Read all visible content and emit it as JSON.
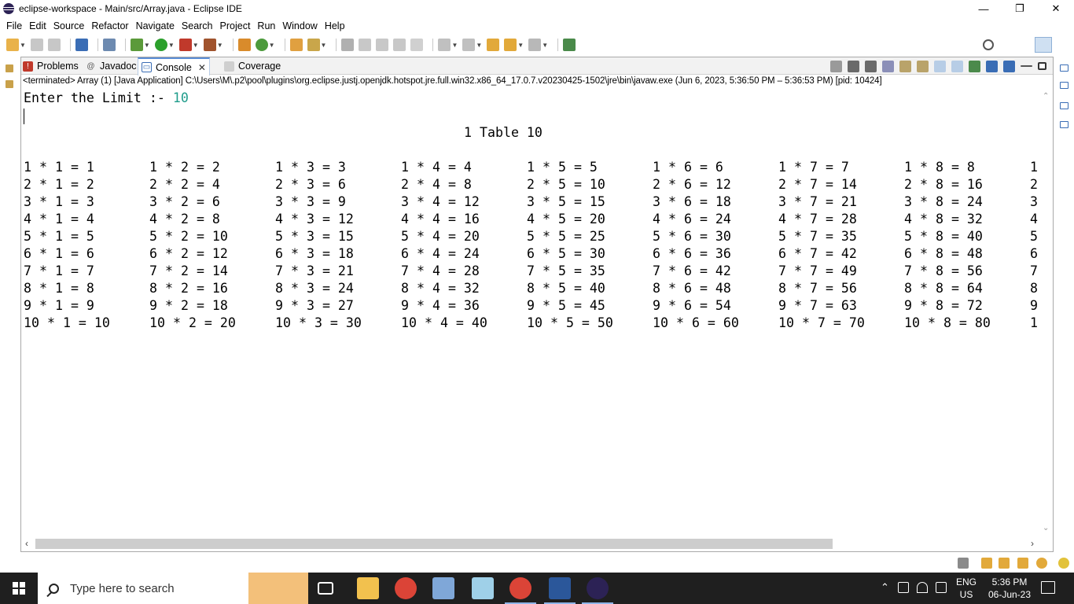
{
  "window": {
    "title": "eclipse-workspace - Main/src/Array.java - Eclipse IDE",
    "controls": {
      "minimize": "—",
      "maximize": "❐",
      "close": "✕"
    }
  },
  "menu": [
    "File",
    "Edit",
    "Source",
    "Refactor",
    "Navigate",
    "Search",
    "Project",
    "Run",
    "Window",
    "Help"
  ],
  "views": {
    "tabs": [
      {
        "label": "Problems",
        "icon": "problems-icon"
      },
      {
        "label": "Javadoc",
        "icon": "javadoc-icon"
      },
      {
        "label": "Console",
        "icon": "console-icon",
        "active": true
      },
      {
        "label": "Coverage",
        "icon": "coverage-icon"
      }
    ]
  },
  "console": {
    "status": "<terminated> Array (1) [Java Application] C:\\Users\\M\\.p2\\pool\\plugins\\org.eclipse.justj.openjdk.hotspot.jre.full.win32.x86_64_17.0.7.v20230425-1502\\jre\\bin\\javaw.exe  (Jun 6, 2023, 5:36:50 PM – 5:36:53 PM) [pid: 10424]",
    "prompt": "Enter the Limit :- ",
    "input_value": "10",
    "table_title": "1 Table 10",
    "columns": [
      [
        "1 * 1 = 1",
        "2 * 1 = 2",
        "3 * 1 = 3",
        "4 * 1 = 4",
        "5 * 1 = 5",
        "6 * 1 = 6",
        "7 * 1 = 7",
        "8 * 1 = 8",
        "9 * 1 = 9",
        "10 * 1 = 10"
      ],
      [
        "1 * 2 = 2",
        "2 * 2 = 4",
        "3 * 2 = 6",
        "4 * 2 = 8",
        "5 * 2 = 10",
        "6 * 2 = 12",
        "7 * 2 = 14",
        "8 * 2 = 16",
        "9 * 2 = 18",
        "10 * 2 = 20"
      ],
      [
        "1 * 3 = 3",
        "2 * 3 = 6",
        "3 * 3 = 9",
        "4 * 3 = 12",
        "5 * 3 = 15",
        "6 * 3 = 18",
        "7 * 3 = 21",
        "8 * 3 = 24",
        "9 * 3 = 27",
        "10 * 3 = 30"
      ],
      [
        "1 * 4 = 4",
        "2 * 4 = 8",
        "3 * 4 = 12",
        "4 * 4 = 16",
        "5 * 4 = 20",
        "6 * 4 = 24",
        "7 * 4 = 28",
        "8 * 4 = 32",
        "9 * 4 = 36",
        "10 * 4 = 40"
      ],
      [
        "1 * 5 = 5",
        "2 * 5 = 10",
        "3 * 5 = 15",
        "4 * 5 = 20",
        "5 * 5 = 25",
        "6 * 5 = 30",
        "7 * 5 = 35",
        "8 * 5 = 40",
        "9 * 5 = 45",
        "10 * 5 = 50"
      ],
      [
        "1 * 6 = 6",
        "2 * 6 = 12",
        "3 * 6 = 18",
        "4 * 6 = 24",
        "5 * 6 = 30",
        "6 * 6 = 36",
        "7 * 6 = 42",
        "8 * 6 = 48",
        "9 * 6 = 54",
        "10 * 6 = 60"
      ],
      [
        "1 * 7 = 7",
        "2 * 7 = 14",
        "3 * 7 = 21",
        "4 * 7 = 28",
        "5 * 7 = 35",
        "6 * 7 = 42",
        "7 * 7 = 49",
        "8 * 7 = 56",
        "9 * 7 = 63",
        "10 * 7 = 70"
      ],
      [
        "1 * 8 = 8",
        "2 * 8 = 16",
        "3 * 8 = 24",
        "4 * 8 = 32",
        "5 * 8 = 40",
        "6 * 8 = 48",
        "7 * 8 = 56",
        "8 * 8 = 64",
        "9 * 8 = 72",
        "10 * 8 = 80"
      ],
      [
        "1",
        "2",
        "3",
        "4",
        "5",
        "6",
        "7",
        "8",
        "9",
        "1"
      ]
    ],
    "colors": {
      "input": "#1f9c8b",
      "text": "#000000"
    }
  },
  "taskbar": {
    "search_placeholder": "Type here to search",
    "apps": [
      "task-view-icon",
      "file-explorer-icon",
      "chrome-icon",
      "remote-desktop-icon",
      "notepad-icon",
      "chrome-profile-icon",
      "word-icon",
      "eclipse-icon"
    ],
    "language": {
      "line1": "ENG",
      "line2": "US"
    },
    "clock": {
      "time": "5:36 PM",
      "date": "06-Jun-23"
    }
  }
}
